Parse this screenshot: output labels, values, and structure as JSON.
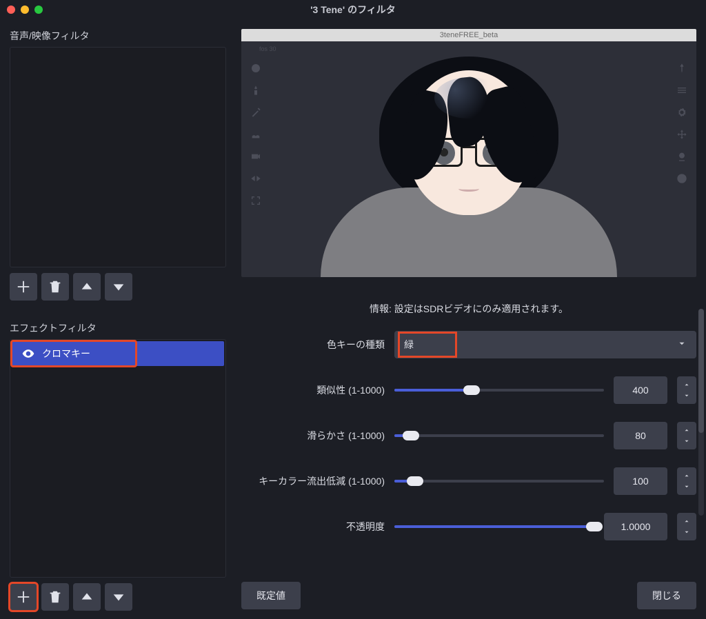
{
  "window": {
    "title": "'3 Tene' のフィルタ"
  },
  "sidebar": {
    "audio_label": "音声/映像フィルタ",
    "effect_label": "エフェクトフィルタ",
    "effect_items": [
      {
        "label": "クロマキー"
      }
    ]
  },
  "preview": {
    "inner_title": "3teneFREE_beta",
    "small_label": "fos 30"
  },
  "settings": {
    "info": "情報: 設定はSDRビデオにのみ適用されます。",
    "key_type_label": "色キーの種類",
    "key_type_value": "緑",
    "sliders": {
      "similarity": {
        "label": "類似性 (1-1000)",
        "value": "400",
        "pct": 37
      },
      "smoothness": {
        "label": "滑らかさ (1-1000)",
        "value": "80",
        "pct": 8
      },
      "spill": {
        "label": "キーカラー流出低減 (1-1000)",
        "value": "100",
        "pct": 10
      },
      "opacity": {
        "label": "不透明度",
        "value": "1.0000",
        "pct": 100
      }
    }
  },
  "buttons": {
    "defaults": "既定値",
    "close": "閉じる"
  }
}
